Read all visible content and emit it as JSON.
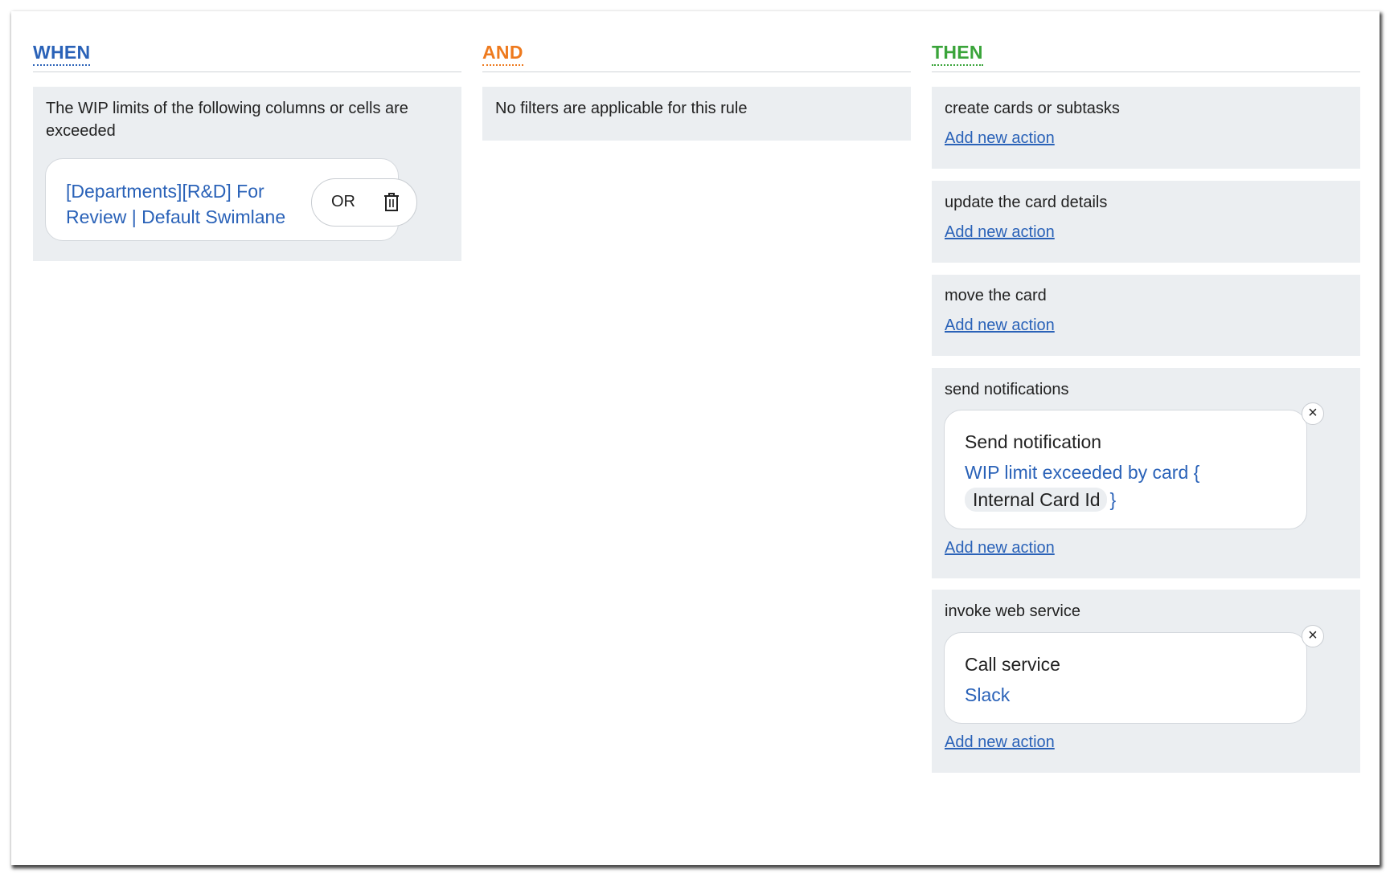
{
  "when": {
    "title": "WHEN",
    "color": "#2a62b8",
    "description": "The WIP limits of the following columns or cells are exceeded",
    "condition": {
      "text": "[Departments][R&D] For Review | Default Swimlane",
      "operator": "OR",
      "delete_icon": "trash-icon"
    }
  },
  "and": {
    "title": "AND",
    "color": "#ee7a1e",
    "description": "No filters are applicable for this rule"
  },
  "then": {
    "title": "THEN",
    "color": "#3aa43a",
    "groups": [
      {
        "title": "create cards or subtasks",
        "add_label": "Add new action"
      },
      {
        "title": "update the card details",
        "add_label": "Add new action"
      },
      {
        "title": "move the card",
        "add_label": "Add new action"
      },
      {
        "title": "send notifications",
        "add_label": "Add new action",
        "action": {
          "title": "Send notification",
          "value": "WIP limit exceeded by card {",
          "chip": "Internal Card Id",
          "value_end": "}",
          "close": "×"
        }
      },
      {
        "title": "invoke web service",
        "add_label": "Add new action",
        "action": {
          "title": "Call service",
          "value": "Slack",
          "close": "×"
        }
      }
    ]
  }
}
